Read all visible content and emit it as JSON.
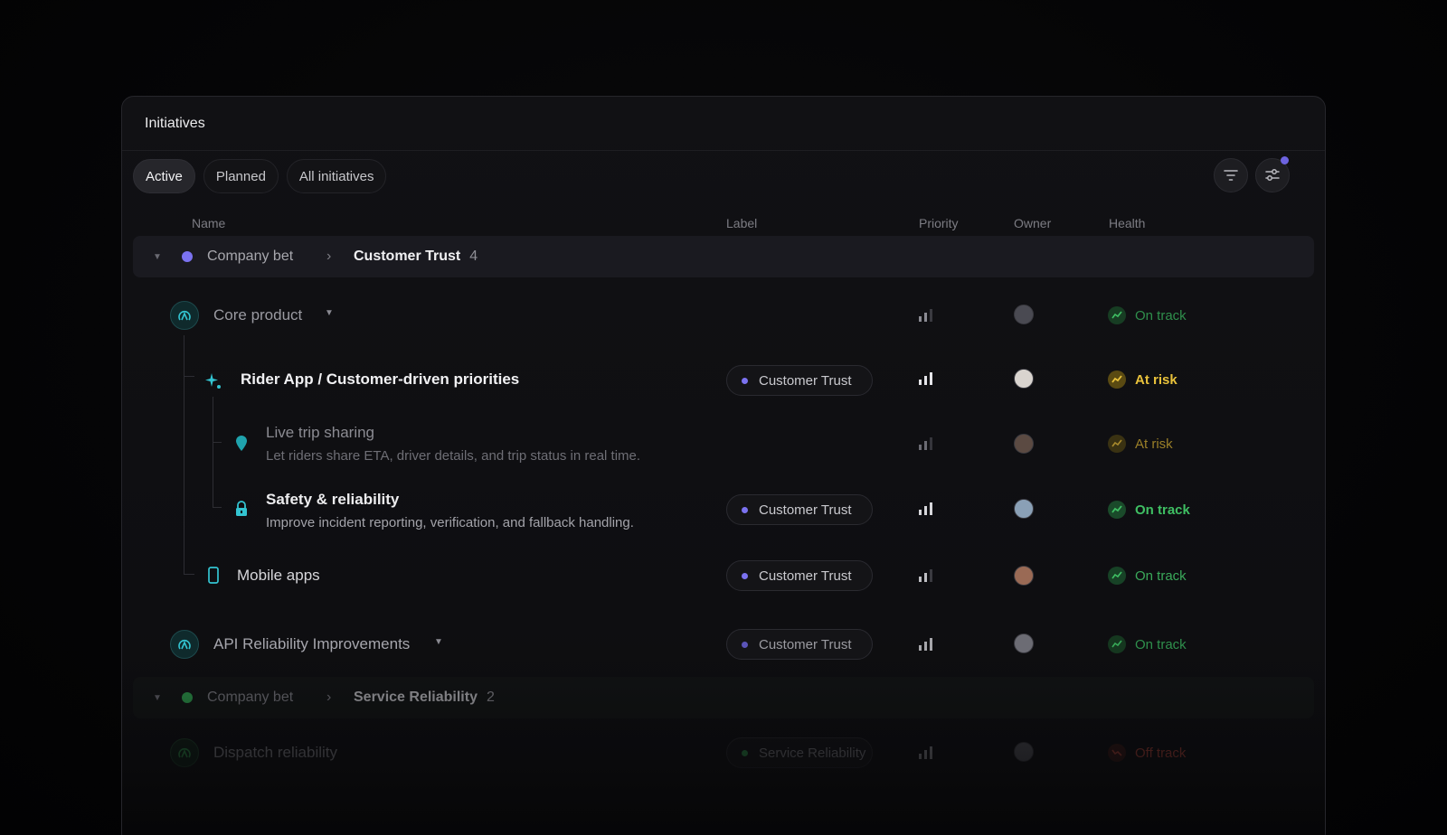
{
  "panel": {
    "title": "Initiatives"
  },
  "tabs": [
    {
      "label": "Active",
      "active": true
    },
    {
      "label": "Planned",
      "active": false
    },
    {
      "label": "All initiatives",
      "active": false
    }
  ],
  "toolbar": {
    "filter_icon": "filter-icon",
    "display_icon": "sliders-icon",
    "accent": "#6d63e0"
  },
  "columns": {
    "name": "Name",
    "label": "Label",
    "priority": "Priority",
    "owner": "Owner",
    "health": "Health"
  },
  "groups": [
    {
      "kind": "Company bet",
      "name": "Customer Trust",
      "count": "4",
      "color": "#7b72f0"
    },
    {
      "kind": "Company bet",
      "name": "Service Reliability",
      "count": "2",
      "color": "#2fa44f"
    }
  ],
  "rows": [
    {
      "name": "Core product",
      "label": "",
      "health": "On track",
      "icon": "initiative-ring-icon"
    },
    {
      "name": "Rider App / Customer-driven priorities",
      "label": "Customer Trust",
      "health": "At risk",
      "icon": "sparkle-icon"
    },
    {
      "name": "Live trip sharing",
      "description": "Let riders share ETA, driver details, and trip status in real time.",
      "label": "",
      "health": "At risk",
      "icon": "location-pin-icon"
    },
    {
      "name": "Safety & reliability",
      "description": "Improve incident reporting, verification, and fallback handling.",
      "label": "Customer Trust",
      "health": "On track",
      "icon": "lock-icon"
    },
    {
      "name": "Mobile apps",
      "label": "Customer Trust",
      "health": "On track",
      "icon": "mobile-icon"
    },
    {
      "name": "API Reliability Improvements",
      "label": "Customer Trust",
      "health": "On track",
      "icon": "initiative-ring-icon"
    },
    {
      "name": "Dispatch reliability",
      "label": "Service Reliability",
      "health": "Off track",
      "icon": "initiative-ring-icon"
    }
  ],
  "colors": {
    "on_track": "#3fbf63",
    "at_risk": "#e9c23b",
    "off_track": "#c94a3c",
    "label_dot_trust": "#7b72f0",
    "label_dot_service": "#2fa44f",
    "teal_icon": "#33c4d1"
  }
}
